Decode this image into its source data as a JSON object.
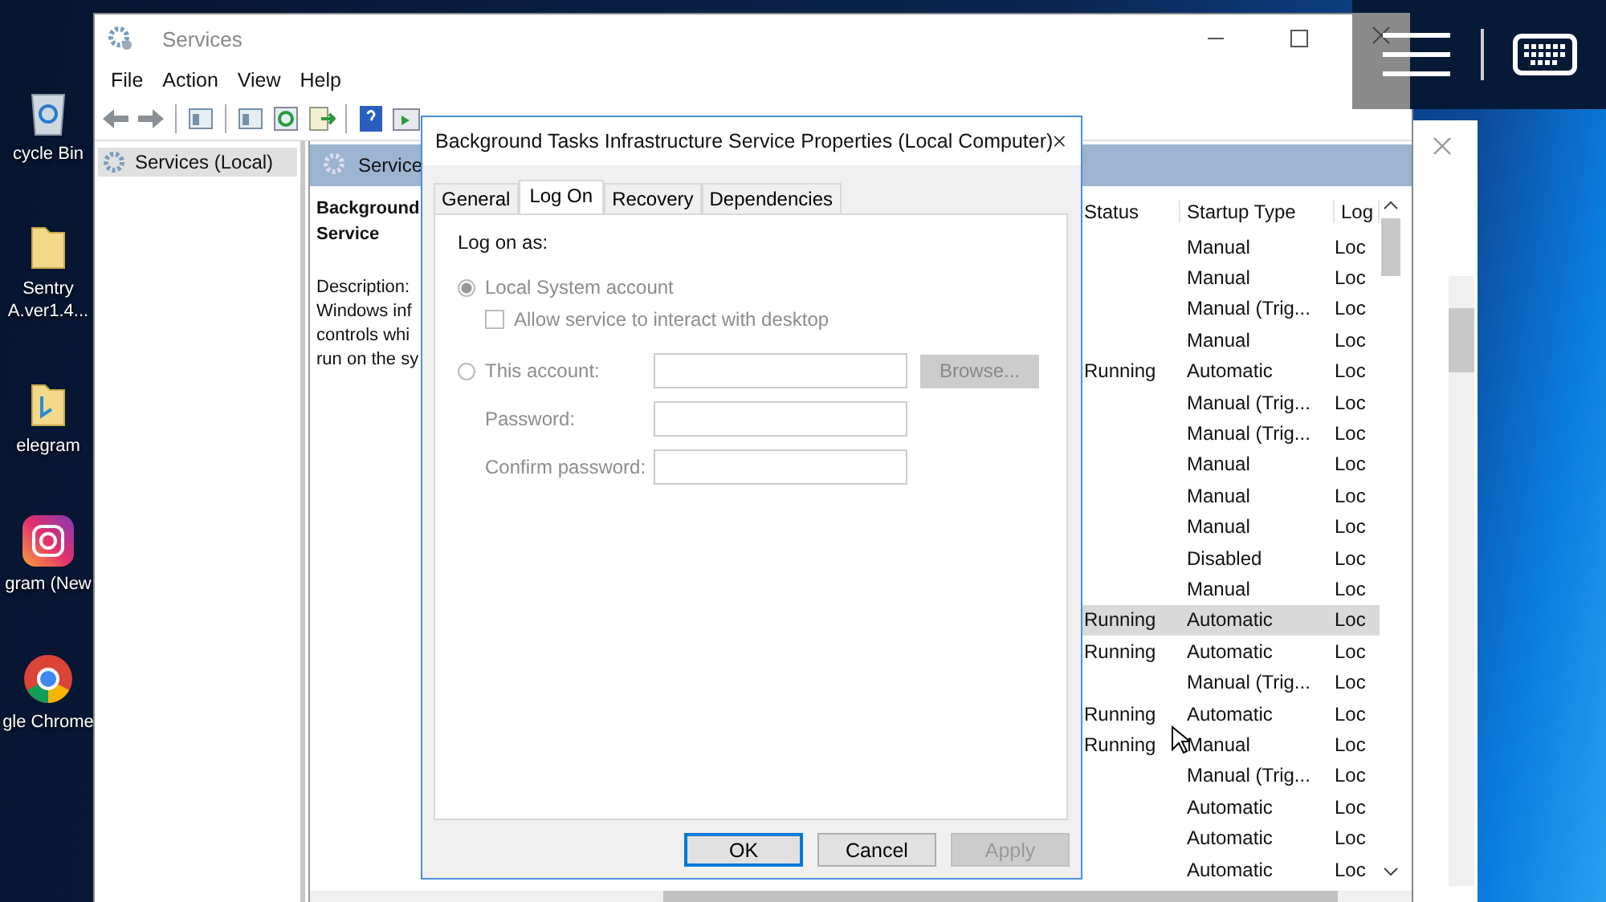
{
  "desktop_icons": [
    {
      "kind": "recycle",
      "label": "cycle Bin"
    },
    {
      "kind": "folder",
      "label": "Sentry A.ver1.4..."
    },
    {
      "kind": "folder-app",
      "label": "elegram"
    },
    {
      "kind": "camera",
      "label": "gram (New"
    },
    {
      "kind": "browser",
      "label": "gle Chrome"
    }
  ],
  "services_window": {
    "title": "Services",
    "menu": [
      "File",
      "Action",
      "View",
      "Help"
    ],
    "tree": [
      {
        "label": "Services (Local)",
        "selected": true
      }
    ],
    "pane_title": "Service",
    "details": {
      "heading": "Background Service",
      "description_label": "Description:",
      "description_lines": [
        "Windows inf",
        "controls whi",
        "run on the sy"
      ]
    },
    "columns": [
      "Status",
      "Startup Type",
      "Log"
    ],
    "rows": [
      {
        "status": "",
        "startup_type": "Manual",
        "log_on": "Loc",
        "selected": false
      },
      {
        "status": "",
        "startup_type": "Manual",
        "log_on": "Loc",
        "selected": false
      },
      {
        "status": "",
        "startup_type": "Manual (Trig...",
        "log_on": "Loc",
        "selected": false
      },
      {
        "status": "",
        "startup_type": "Manual",
        "log_on": "Loc",
        "selected": false
      },
      {
        "status": "Running",
        "startup_type": "Automatic",
        "log_on": "Loc",
        "selected": false
      },
      {
        "status": "",
        "startup_type": "Manual (Trig...",
        "log_on": "Loc",
        "selected": false
      },
      {
        "status": "",
        "startup_type": "Manual (Trig...",
        "log_on": "Loc",
        "selected": false
      },
      {
        "status": "",
        "startup_type": "Manual",
        "log_on": "Loc",
        "selected": false
      },
      {
        "status": "",
        "startup_type": "Manual",
        "log_on": "Loc",
        "selected": false
      },
      {
        "status": "",
        "startup_type": "Manual",
        "log_on": "Loc",
        "selected": false
      },
      {
        "status": "",
        "startup_type": "Disabled",
        "log_on": "Loc",
        "selected": false
      },
      {
        "status": "",
        "startup_type": "Manual",
        "log_on": "Loc",
        "selected": false
      },
      {
        "status": "Running",
        "startup_type": "Automatic",
        "log_on": "Loc",
        "selected": true
      },
      {
        "status": "Running",
        "startup_type": "Automatic",
        "log_on": "Loc",
        "selected": false
      },
      {
        "status": "",
        "startup_type": "Manual (Trig...",
        "log_on": "Loc",
        "selected": false
      },
      {
        "status": "Running",
        "startup_type": "Automatic",
        "log_on": "Loc",
        "selected": false
      },
      {
        "status": "Running",
        "startup_type": "Manual",
        "log_on": "Loc",
        "selected": false
      },
      {
        "status": "",
        "startup_type": "Manual (Trig...",
        "log_on": "Loc",
        "selected": false
      },
      {
        "status": "",
        "startup_type": "Automatic",
        "log_on": "Loc",
        "selected": false
      },
      {
        "status": "",
        "startup_type": "Automatic",
        "log_on": "Loc",
        "selected": false
      },
      {
        "status": "",
        "startup_type": "Automatic",
        "log_on": "Loc",
        "selected": false
      }
    ]
  },
  "dialog": {
    "title": "Background Tasks Infrastructure Service Properties (Local Computer)",
    "tabs": [
      {
        "label": "General",
        "selected": false
      },
      {
        "label": "Log On",
        "selected": true
      },
      {
        "label": "Recovery",
        "selected": false
      },
      {
        "label": "Dependencies",
        "selected": false
      }
    ],
    "log_on_as": "Log on as:",
    "local_system": {
      "label": "Local System account",
      "selected": true,
      "disabled": true
    },
    "interact_checkbox": {
      "label": "Allow service to interact with desktop",
      "checked": false,
      "disabled": true
    },
    "this_account": {
      "label": "This account:",
      "selected": false,
      "disabled": true
    },
    "browse_button": {
      "label": "Browse...",
      "disabled": true
    },
    "fields": [
      {
        "label": "Password:"
      },
      {
        "label": "Confirm password:"
      }
    ],
    "buttons": [
      {
        "label": "OK",
        "default": true,
        "disabled": false
      },
      {
        "label": "Cancel",
        "default": false,
        "disabled": false
      },
      {
        "label": "Apply",
        "default": false,
        "disabled": true
      }
    ]
  }
}
